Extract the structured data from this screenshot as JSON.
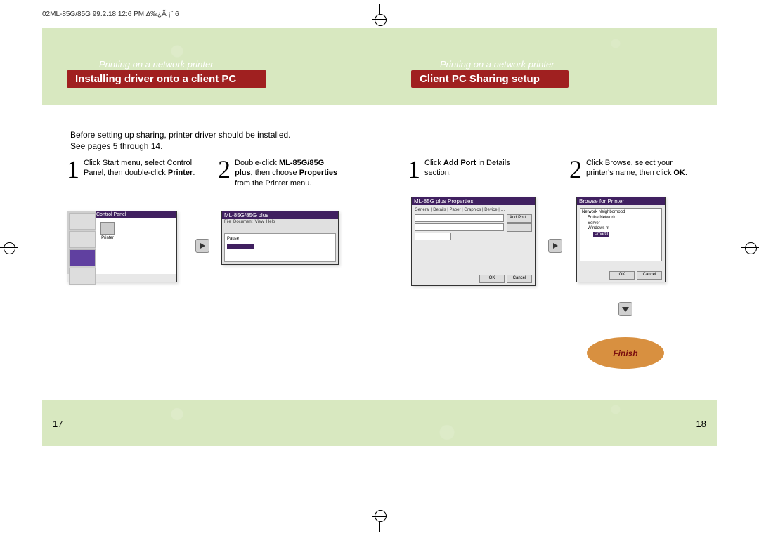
{
  "header": "02ML-85G/85G  99.2.18 12:6 PM  ∆‰¿Ã ¡ˆ 6",
  "left": {
    "caption": "Printing on a network printer",
    "title": "Installing driver onto a client PC",
    "intro1": "Before setting up sharing, printer driver should be installed.",
    "intro2": "See pages 5 through 14.",
    "step1_num": "1",
    "step1_a": "Click Start menu, select Control",
    "step1_b": "Panel, then double-click ",
    "step1_c": "Printer",
    "step1_d": ".",
    "step2_num": "2",
    "step2_a": "Double-click ",
    "step2_b": "ML-85G/85G",
    "step2_c": "plus,",
    "step2_d": " then choose ",
    "step2_e": "Properties",
    "step2_f": "from the Printer menu.",
    "sc_a_title": "Control Panel",
    "sc_a_printer": "Printer",
    "sc_b_title": "ML-85G/85G plus"
  },
  "right": {
    "caption": "Printing on a network printer",
    "title": "Client PC Sharing setup",
    "step1_num": "1",
    "step1_a": "Click ",
    "step1_b": "Add Port",
    "step1_c": " in Details",
    "step1_d": "section.",
    "step2_num": "2",
    "step2_a": "Click Browse, select your",
    "step2_b": "printer's name, then click ",
    "step2_c": "OK",
    "step2_d": ".",
    "sc_c_title": "ML-85G plus Properties",
    "sc_c_addport": "Add Port...",
    "sc_c_ok": "OK",
    "sc_c_cancel": "Cancel",
    "sc_d_title": "Browse for Printer",
    "sc_d_node1": "Network Neighborhood",
    "sc_d_node2": "Entire Network",
    "sc_d_node3": "Server",
    "sc_d_node4": "Windows nt",
    "sc_d_sel": "SmartII",
    "sc_d_ok": "OK",
    "sc_d_cancel": "Cancel"
  },
  "finish": "Finish",
  "page_left": "17",
  "page_right": "18"
}
